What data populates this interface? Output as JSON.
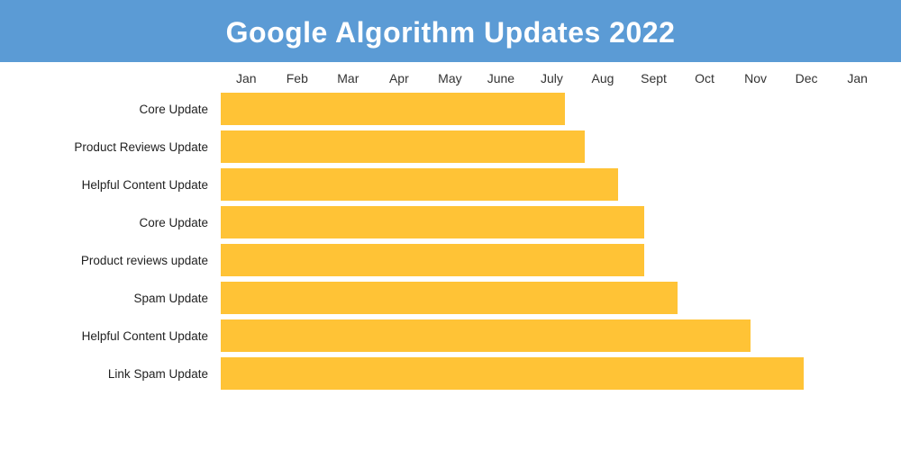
{
  "header": {
    "title": "Google Algorithm Updates 2022"
  },
  "months": [
    "Jan",
    "Feb",
    "Mar",
    "Apr",
    "May",
    "June",
    "July",
    "Aug",
    "Sept",
    "Oct",
    "Nov",
    "Dec",
    "Jan"
  ],
  "bars": [
    {
      "label": "Core Update",
      "widthPct": 52
    },
    {
      "label": "Product Reviews Update",
      "widthPct": 55
    },
    {
      "label": "Helpful Content Update",
      "widthPct": 60
    },
    {
      "label": "Core Update",
      "widthPct": 64
    },
    {
      "label": "Product reviews update",
      "widthPct": 64
    },
    {
      "label": "Spam Update",
      "widthPct": 69
    },
    {
      "label": "Helpful Content Update",
      "widthPct": 80
    },
    {
      "label": "Link Spam Update",
      "widthPct": 88
    }
  ],
  "colors": {
    "header_bg": "#5b9bd5",
    "header_text": "#ffffff",
    "bar_fill": "#ffc336",
    "label_text": "#222222",
    "month_text": "#333333"
  }
}
